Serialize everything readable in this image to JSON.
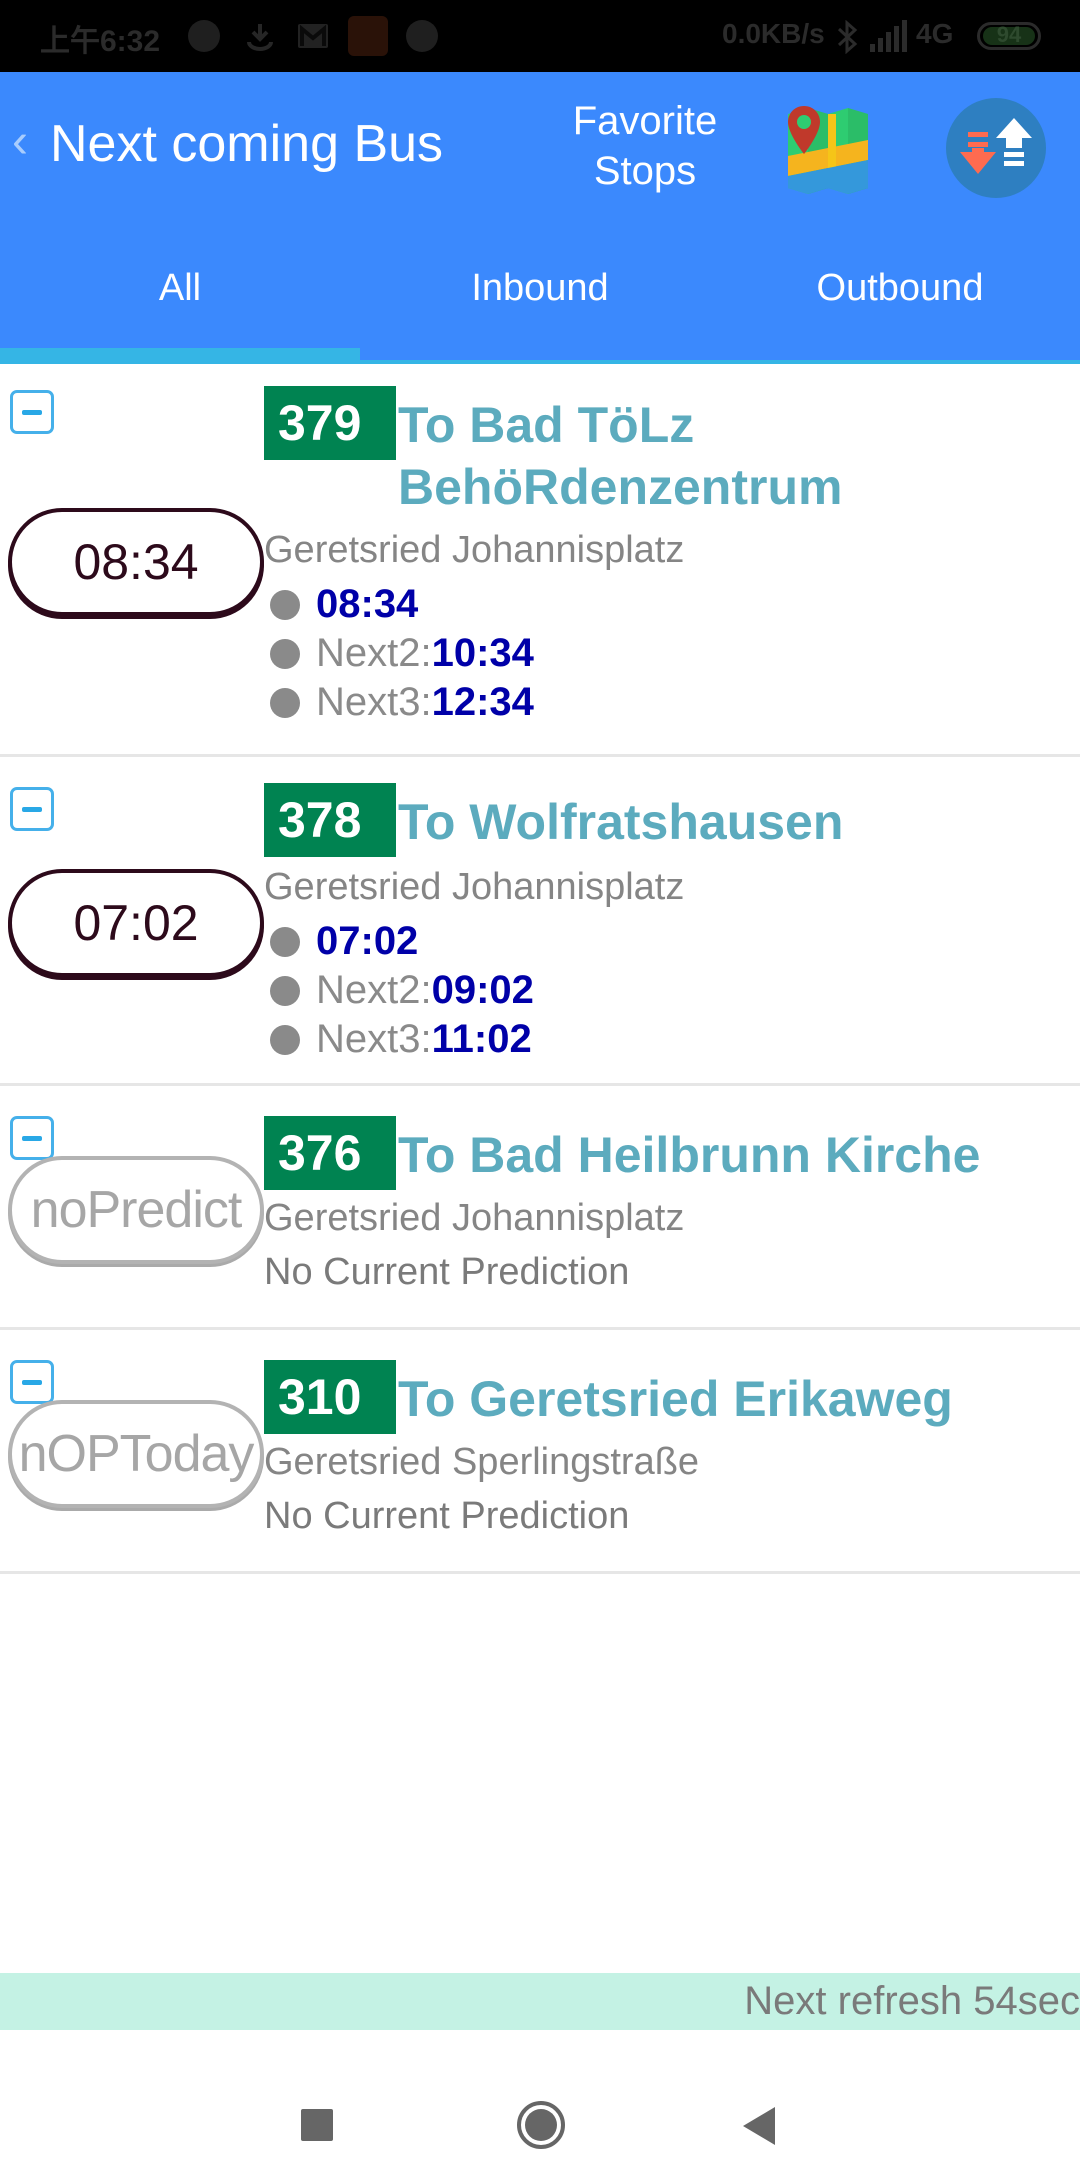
{
  "status_bar": {
    "time": "上午6:32",
    "network_speed": "0.0KB/s",
    "network_type": "4G",
    "battery": "94",
    "icons": [
      "notification-dot-icon",
      "download-icon",
      "gmail-icon",
      "mi-app-icon",
      "notification-dot-icon",
      "bluetooth-icon",
      "signal-icon",
      "battery-icon"
    ]
  },
  "header": {
    "back_glyph": "‹",
    "title": "Next coming Bus",
    "favorite_stops_line1": "Favorite",
    "favorite_stops_line2": "Stops",
    "map_icon": "map-icon",
    "sort_icon": "sort-arrows-icon",
    "colors": {
      "background": "#3b89fd",
      "tab_indicator": "#35b5e5"
    }
  },
  "tabs": [
    {
      "label": "All",
      "active": true
    },
    {
      "label": "Inbound",
      "active": false
    },
    {
      "label": "Outbound",
      "active": false
    }
  ],
  "routes": [
    {
      "pill": "08:34",
      "pill_style": "dark",
      "route": "379",
      "destination": "To Bad TöLz BehöRdenzentrum",
      "stop": "Geretsried Johannisplatz",
      "times": [
        {
          "label": "",
          "value": "08:34"
        },
        {
          "label": "Next2: ",
          "value": "10:34"
        },
        {
          "label": "Next3: ",
          "value": "12:34"
        }
      ]
    },
    {
      "pill": "07:02",
      "pill_style": "dark",
      "route": "378",
      "destination": "To Wolfratshausen",
      "stop": "Geretsried Johannisplatz",
      "times": [
        {
          "label": "",
          "value": "07:02"
        },
        {
          "label": "Next2: ",
          "value": "09:02"
        },
        {
          "label": "Next3: ",
          "value": "11:02"
        }
      ]
    },
    {
      "pill": "noPredict",
      "pill_style": "gray",
      "route": "376",
      "destination": "To Bad Heilbrunn Kirche",
      "stop": "Geretsried Johannisplatz",
      "status": "No Current Prediction"
    },
    {
      "pill": "nOPToday",
      "pill_style": "gray",
      "route": "310",
      "destination": "To Geretsried Erikaweg",
      "stop": "Geretsried Sperlingstraße",
      "status": "No Current Prediction"
    }
  ],
  "footer": {
    "refresh_text": "Next refresh 54sec",
    "colors": {
      "refresh_bg": "#c4f2e4",
      "route_badge": "#008351",
      "destination": "#5cabbe",
      "time_value": "#0000a8"
    }
  },
  "nav_bar": {
    "recent": "recent-apps-icon",
    "home": "home-icon",
    "back": "back-icon"
  }
}
